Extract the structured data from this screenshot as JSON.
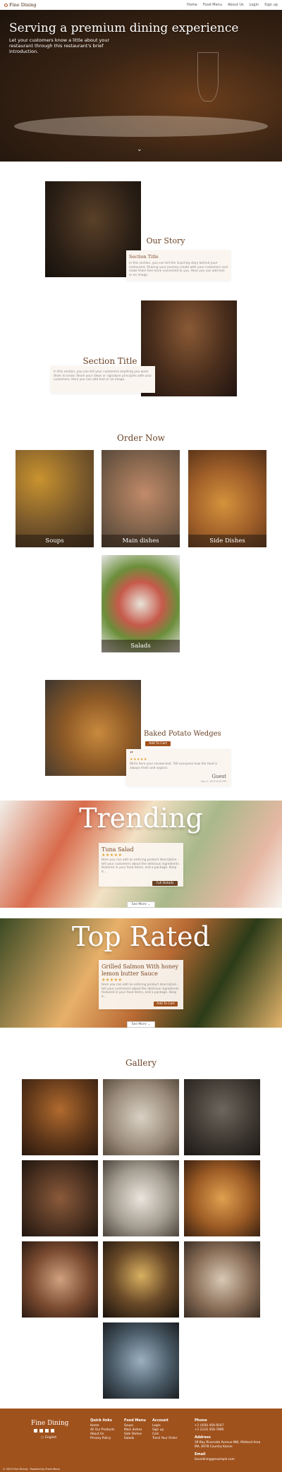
{
  "nav": {
    "brand": "Fine Dining",
    "links": [
      "Home",
      "Food Menu",
      "About Us",
      "Login",
      "Sign up"
    ]
  },
  "hero": {
    "title": "Serving a premium dining experience",
    "subtitle": "Let your customers know a little about your restaurant through this restaurant's brief introduction."
  },
  "story": {
    "title": "Our Story",
    "card_title": "Section Title",
    "card_text": "In this section, you can tell the inspiring story behind your restaurant. Sharing your journey create with your customers and make them feel more connected to you. Here you can add text or an image.",
    "section_title": "Section Title",
    "section_text": "In this section, you can tell your customers anything you want them to know. Share your ideas or signature principles with your customers. Here you can add text or an image."
  },
  "order": {
    "title": "Order Now",
    "categories": [
      "Soups",
      "Main dishes",
      "Side Dishes",
      "Salads"
    ]
  },
  "featured": {
    "title": "Baked Potato Wedges",
    "add_to_cart": "Add To Cart",
    "review_text": "Write here your review text. Tell everyone how the food is always fresh and organic.",
    "reviewer": "Guest",
    "review_date": "Sep 4, 2023 8:00 PM"
  },
  "trending": {
    "title": "Trending",
    "item_name": "Tuna Salad",
    "item_desc": "Here you can add an enticing product description - tell your customers about the delicious ingredients featured in your food items, and a package. Keep it...",
    "button": "Full Details",
    "see_more": "See More"
  },
  "top_rated": {
    "title": "Top Rated",
    "item_name": "Grilled Salmon With honey lemon butter Sauce",
    "item_desc": "Here you can add an enticing product description - tell your customers about the delicious ingredients featured in your food items, and a package. Keep it...",
    "button": "Add To Cart",
    "see_more": "See More"
  },
  "gallery": {
    "title": "Gallery"
  },
  "footer": {
    "brand": "Fine Dining",
    "language": "English",
    "quick_links_head": "Quick links",
    "quick_links": [
      "Home",
      "All Our Products",
      "About Us",
      "Privacy Policy"
    ],
    "food_menu_head": "Food Menu",
    "food_menu": [
      "Soups",
      "Main dishes",
      "Side Dishes",
      "Salads"
    ],
    "account_head": "Account",
    "account": [
      "Login",
      "Sign up",
      "Cart",
      "Track Your Order"
    ],
    "phone_head": "Phone",
    "phone": [
      "+1 (456) 456-9547",
      "+1 (123) 456-7890"
    ],
    "address_head": "Address",
    "address": "39 Bay Riverside Avenue NW, Midland Area MA, 6978 Country Kanon",
    "email_head": "Email",
    "email": "ilovedining@example.com",
    "copyright": "© 2023 Fine Dining · Powered by Fresh Menu"
  },
  "colors": {
    "accent": "#a0521d",
    "heading": "#6b4226",
    "card_bg": "#fbf5ef"
  }
}
